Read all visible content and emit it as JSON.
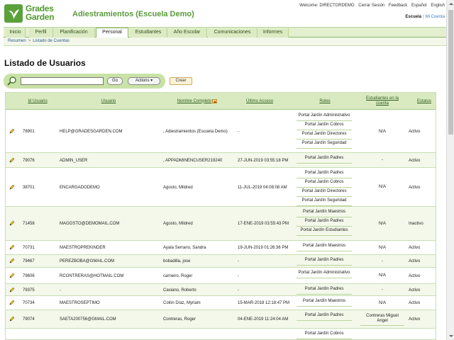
{
  "brand": {
    "line1": "Grades",
    "line2": "Garden",
    "color": "#5aa13a"
  },
  "site_title": "Adiestramientos (Escuela Demo)",
  "top_links": {
    "welcome": "Welcome: DIRECTORDEMO",
    "logout": "Cerrar Sesión",
    "feedback": "Feedback",
    "spanish": "Español",
    "english": "English"
  },
  "top_links2": {
    "escuela": "Escuela",
    "sep": "|",
    "mi_cuenta": "Mi Cuenta"
  },
  "nav": [
    "Inicio",
    "Perfil",
    "Planificación",
    "Personal",
    "Estudiantes",
    "Año Escolar",
    "Comunicaciones",
    "Informes"
  ],
  "nav_active": "Personal",
  "breadcrumb": {
    "first": "Resumen",
    "arrow": ">",
    "second": "Listado de Cuentas"
  },
  "page_title": "Listado de Usuarios",
  "search": {
    "value": "",
    "go": "Go",
    "actions": "Actions",
    "crear": "Crear"
  },
  "columns": {
    "id": "Id Usuario",
    "usuario": "Usuario",
    "nombre": "Nombre Completo",
    "acceso": "Último Acceso",
    "roles": "Roles",
    "estudiantes": "Estudiantes en la cuenta",
    "estatus": "Estatus"
  },
  "rows": [
    {
      "id": "78901",
      "usuario": "HELP@GRADESGARDEN.COM",
      "nombre": ", Adiestramientos (Escuela Demo)",
      "acceso": "-",
      "roles": [
        "Portal Jardín Administrativo",
        "Portal Jardín Cobros",
        "Portal Jardín Directores",
        "Portal Jardín Seguridad"
      ],
      "estudiantes": "N/A",
      "estatus": "Activo"
    },
    {
      "id": "79076",
      "usuario": "ADMIN_USER",
      "nombre": ", APPADMINENCUSER219240",
      "acceso": "27-JUN-2019 03:55:18 PM",
      "roles": [
        "Portal Jardín Padres"
      ],
      "estudiantes": "-",
      "estatus": "Activo"
    },
    {
      "id": "38701",
      "usuario": "ENCARGADODEMO",
      "nombre": "Agosto, Mildred",
      "acceso": "11-JUL-2019 04:08:08 AM",
      "roles": [
        "Portal Jardín Padres",
        "Portal Jardín Cobros",
        "Portal Jardín Directores",
        "Portal Jardín Seguridad"
      ],
      "estudiantes": "N/A",
      "estatus": "Activo"
    },
    {
      "id": "71458",
      "usuario": "MAGOSTO@DEMOMAIL.COM",
      "nombre": "Agosto, Mildred",
      "acceso": "17-ENE-2019 03:55:43 PM",
      "roles": [
        "Portal Jardín Maestros",
        "Portal Jardín Padres",
        "Portal Jardín Estudiantes"
      ],
      "estudiantes": "N/A",
      "estatus": "Inactivo"
    },
    {
      "id": "70731",
      "usuario": "MAESTROPREKINDER",
      "nombre": "Ayala Serrano, Sandra",
      "acceso": "19-JUN-2019 01:26:36 PM",
      "roles": [
        "Portal Jardín Maestros"
      ],
      "estudiantes": "N/A",
      "estatus": "Activo"
    },
    {
      "id": "79467",
      "usuario": "PEREZBOBA@GMAIL.COM",
      "nombre": "bobadilla, jose",
      "acceso": "-",
      "roles": [
        "Portal Jardín Padres"
      ],
      "estudiantes": "-",
      "estatus": "Activo"
    },
    {
      "id": "79606",
      "usuario": "RCONTRERAS@HOTMAIL.COM",
      "nombre": "carneiro, Roger",
      "acceso": "-",
      "roles": [
        "Portal Jardín Administrativo"
      ],
      "estudiantes": "N/A",
      "estatus": "Activo"
    },
    {
      "id": "79375",
      "usuario": "-",
      "nombre": "Casiano, Roberto",
      "acceso": "-",
      "roles": [
        "Portal Jardín Padres"
      ],
      "estudiantes": "-",
      "estatus": "Activo"
    },
    {
      "id": "70734",
      "usuario": "MAESTROSEPTIMO",
      "nombre": "Colón Díaz, Myriam",
      "acceso": "15-MAR-2018 12:18:47 PM",
      "roles": [
        "Portal Jardín Maestros"
      ],
      "estudiantes": "N/A",
      "estatus": "Activo"
    },
    {
      "id": "79074",
      "usuario": "SAETA200756@GMAIL.COM",
      "nombre": "Contreras, Roger",
      "acceso": "04-ENE-2019 11:24:04 AM",
      "roles": [
        "Portal Jardín Padres"
      ],
      "estudiantes": "Contreras Miguel Angel",
      "estatus": "Activo"
    },
    {
      "id": "",
      "usuario": "",
      "nombre": "",
      "acceso": "",
      "roles": [
        "Portal Jardín Cobros"
      ],
      "estudiantes": "",
      "estatus": ""
    }
  ]
}
